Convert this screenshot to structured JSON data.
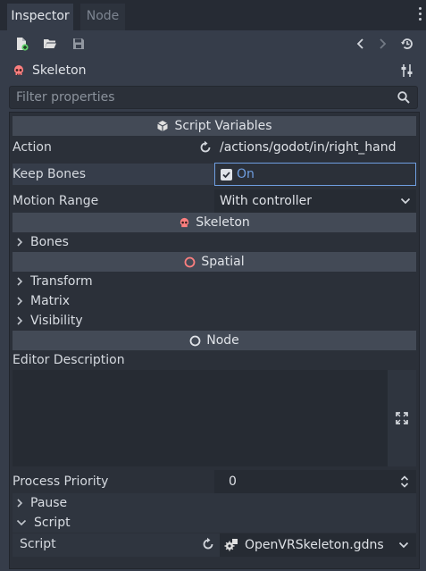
{
  "tabs": {
    "inspector": "Inspector",
    "node": "Node"
  },
  "node": {
    "name": "Skeleton"
  },
  "filter": {
    "placeholder": "Filter properties"
  },
  "sections": {
    "script_variables": "Script Variables",
    "skeleton": "Skeleton",
    "spatial": "Spatial",
    "node": "Node"
  },
  "props": {
    "action_label": "Action",
    "action_value": "/actions/godot/in/right_hand",
    "keep_bones_label": "Keep Bones",
    "keep_bones_value": "On",
    "motion_range_label": "Motion Range",
    "motion_range_value": "With controller",
    "editor_description_label": "Editor Description",
    "process_priority_label": "Process Priority",
    "process_priority_value": "0",
    "script_label": "Script",
    "script_value": "OpenVRSkeleton.gdns"
  },
  "groups": {
    "bones": "Bones",
    "transform": "Transform",
    "matrix": "Matrix",
    "visibility": "Visibility",
    "pause": "Pause",
    "script": "Script"
  },
  "colors": {
    "accent": "#6f9ee0",
    "skeleton_icon": "#fc7f7f",
    "background": "#363d4a",
    "panel": "#2b3039",
    "section": "#434a56"
  }
}
